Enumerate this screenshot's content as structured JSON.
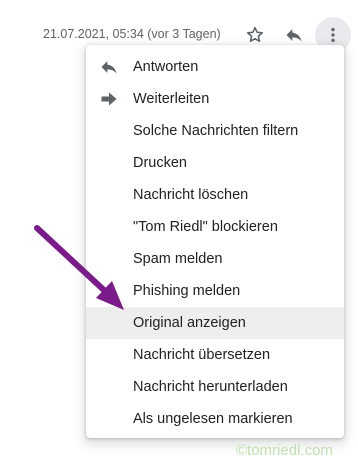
{
  "header": {
    "timestamp": "21.07.2021, 05:34 (vor 3 Tagen)",
    "star_icon": "star-outline-icon",
    "reply_icon": "reply-icon",
    "more_icon": "more-vertical-icon"
  },
  "menu": {
    "items": [
      {
        "label": "Antworten",
        "icon": "reply-icon"
      },
      {
        "label": "Weiterleiten",
        "icon": "forward-icon"
      },
      {
        "label": "Solche Nachrichten filtern"
      },
      {
        "label": "Drucken"
      },
      {
        "label": "Nachricht löschen"
      },
      {
        "label": "\"Tom Riedl\" blockieren"
      },
      {
        "label": "Spam melden"
      },
      {
        "label": "Phishing melden"
      },
      {
        "label": "Original anzeigen",
        "highlighted": true
      },
      {
        "label": "Nachricht übersetzen"
      },
      {
        "label": "Nachricht herunterladen"
      },
      {
        "label": "Als ungelesen markieren"
      }
    ]
  },
  "annotation": {
    "arrow_color": "#7b1a8a"
  },
  "watermark": {
    "text": "©tomriedl.com"
  },
  "colors": {
    "menu_highlight": "#eeeeee",
    "icon_gray": "#5f6368"
  }
}
